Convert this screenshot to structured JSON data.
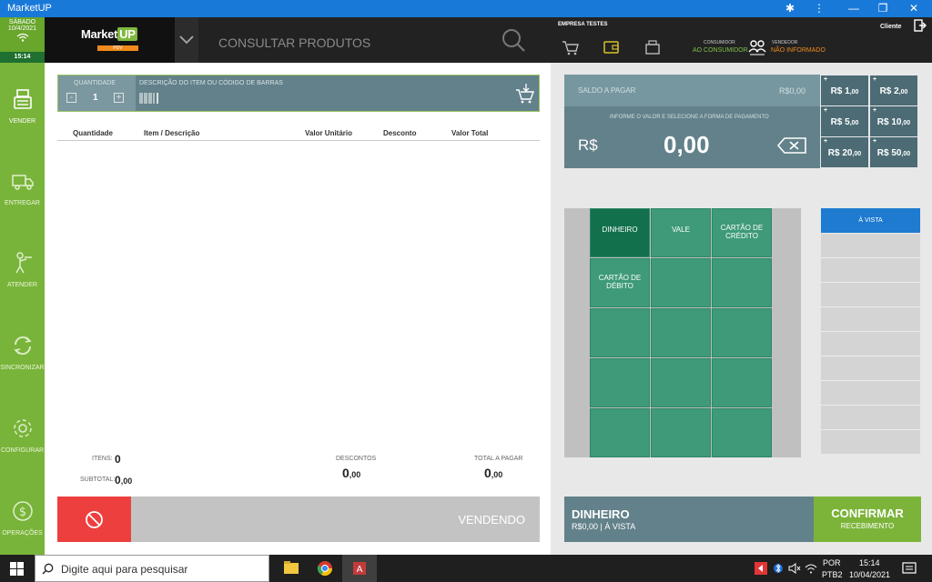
{
  "window": {
    "title": "MarketUP"
  },
  "sidebar": {
    "date_day": "SÁBADO",
    "date": "10/4/2021",
    "time": "15:14",
    "items": [
      {
        "label": "VENDER",
        "icon": "register-icon"
      },
      {
        "label": "ENTREGAR",
        "icon": "truck-icon"
      },
      {
        "label": "ATENDER",
        "icon": "waiter-icon"
      },
      {
        "label": "SINCRONIZAR",
        "icon": "sync-icon"
      },
      {
        "label": "CONFIGURAR",
        "icon": "gear-icon"
      },
      {
        "label": "OPERAÇÕES",
        "icon": "money-icon"
      }
    ]
  },
  "header": {
    "logo_text": "Market",
    "logo_up": "UP",
    "logo_sub": "PDV",
    "search_placeholder": "CONSULTAR PRODUTOS",
    "company": "EMPRESA TESTES",
    "client_label": "Cliente",
    "consumer_label": "CONSUMIDOR",
    "consumer_value": "AO CONSUMIDOR",
    "seller_label": "VENDEDOR",
    "seller_value": "NÃO INFORMADO"
  },
  "sale": {
    "qty_label": "QUANTIDADE",
    "qty_value": "1",
    "qty_minus": "-",
    "qty_plus": "+",
    "desc_placeholder": "DESCRIÇÃO DO ITEM OU CÓDIGO DE BARRAS",
    "columns": [
      "Quantidade",
      "Item / Descrição",
      "Valor Unitário",
      "Desconto",
      "Valor Total"
    ],
    "itens_label": "ITENS:",
    "itens_value": "0",
    "subtotal_label": "SUBTOTAL:",
    "subtotal_int": "0",
    "subtotal_dec": ",00",
    "descontos_label": "DESCONTOS",
    "descontos_int": "0",
    "descontos_dec": ",00",
    "total_label": "TOTAL A PAGAR",
    "total_int": "0",
    "total_dec": ",00",
    "status_button": "VENDENDO"
  },
  "payment": {
    "saldo_label": "SALDO A PAGAR",
    "saldo_value": "R$0,00",
    "instruction": "INFORME O VALOR E SELECIONE A FORMA DE PAGAMENTO",
    "currency": "R$",
    "amount": "0,00",
    "cash_buttons": [
      {
        "int": "R$ 1",
        "dec": ",00"
      },
      {
        "int": "R$ 2",
        "dec": ",00"
      },
      {
        "int": "R$ 5",
        "dec": ",00"
      },
      {
        "int": "R$ 10",
        "dec": ",00"
      },
      {
        "int": "R$ 20",
        "dec": ",00"
      },
      {
        "int": "R$ 50",
        "dec": ",00"
      }
    ],
    "methods": [
      "DINHEIRO",
      "VALE",
      "CARTÃO DE CRÉDITO",
      "CARTÃO DE DÉBITO"
    ],
    "avista_label": "À VISTA",
    "selected_method": "DINHEIRO",
    "selected_summary": "R$0,00 | À VISTA",
    "confirm_label": "CONFIRMAR",
    "confirm_sub": "RECEBIMENTO"
  },
  "taskbar": {
    "search_placeholder": "Digite aqui para pesquisar",
    "lang1": "POR",
    "lang2": "PTB2",
    "time": "15:14",
    "date": "10/04/2021"
  }
}
